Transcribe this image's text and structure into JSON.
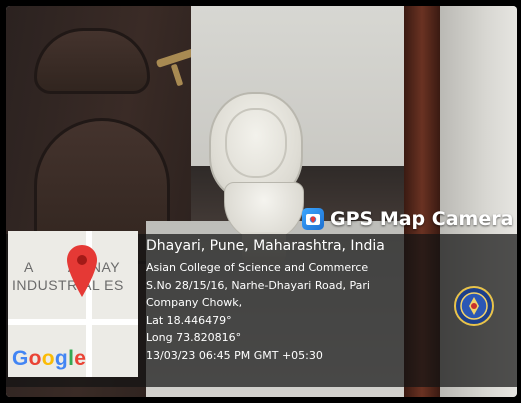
{
  "banner": {
    "app_icon": "map-camera-icon",
    "app_title": "GPS Map Camera"
  },
  "map": {
    "label_line1": "AVINAY",
    "label_line1_prefix": "A",
    "label_line2": "INDUSTRIAL ES",
    "pin_icon": "map-pin-icon",
    "pin_color": "#e53935",
    "google_letters": [
      {
        "ch": "G",
        "color": "#4285F4"
      },
      {
        "ch": "o",
        "color": "#EA4335"
      },
      {
        "ch": "o",
        "color": "#FBBC05"
      },
      {
        "ch": "g",
        "color": "#4285F4"
      },
      {
        "ch": "l",
        "color": "#34A853"
      },
      {
        "ch": "e",
        "color": "#EA4335"
      }
    ]
  },
  "location": {
    "heading": "Dhayari, Pune, Maharashtra, India",
    "lines": [
      "Asian College of Science and Commerce",
      "S.No 28/15/16, Narhe-Dhayari Road, Pari",
      "Company Chowk,",
      "Lat 18.446479°",
      "Long 73.820816°",
      "13/03/23 06:45 PM GMT +05:30"
    ]
  },
  "logo": {
    "icon": "college-seal-icon"
  }
}
